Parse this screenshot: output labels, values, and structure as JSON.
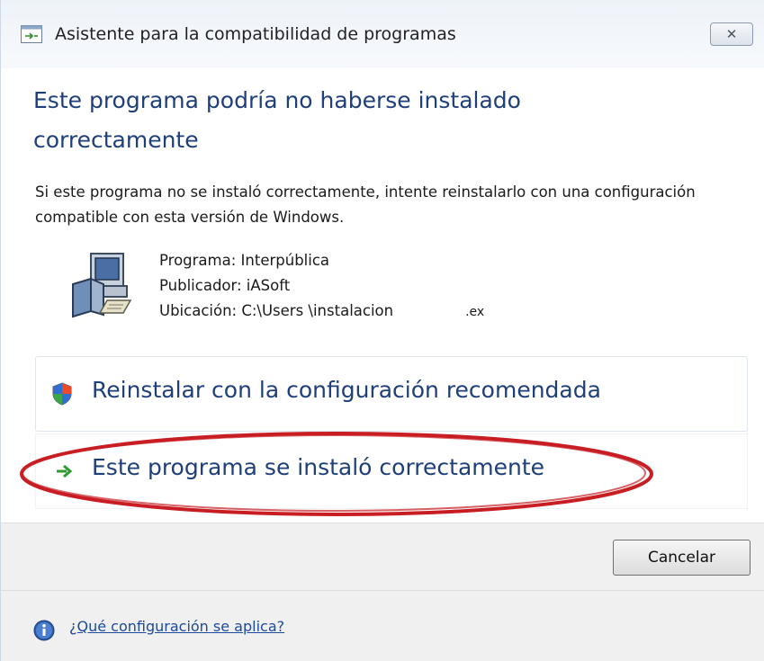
{
  "window": {
    "title": "Asistente para la compatibilidad de programas",
    "close_glyph": "✕"
  },
  "main": {
    "heading": "Este programa podría no haberse instalado correctamente",
    "description": "Si este programa no se instaló correctamente, intente reinstalarlo con una configuración compatible con esta versión de Windows.",
    "program_line": "Programa: Interpública",
    "publisher_line": "Publicador: iASoft",
    "location_line": "Ubicación: C:\\Users \\instalacion",
    "location_ext": ".ex",
    "options": [
      {
        "label": "Reinstalar con la configuración recomendada",
        "icon": "shield-icon"
      },
      {
        "label": "Este programa se instaló correctamente",
        "icon": "green-arrow-icon"
      }
    ],
    "highlight_color": "#c81e23"
  },
  "footer": {
    "cancel_label": "Cancelar",
    "help_link": "¿Qué configuración se aplica?"
  },
  "colors": {
    "heading": "#1e3f7a",
    "link": "#1c4a9c",
    "footer_bg": "#f0f0f0"
  }
}
